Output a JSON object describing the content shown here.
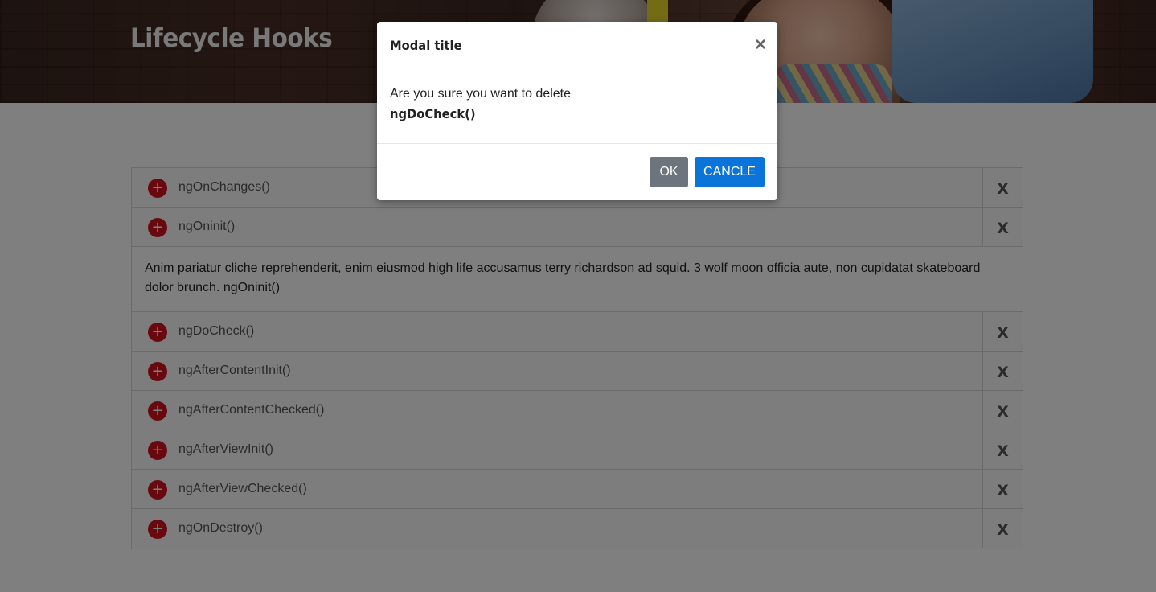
{
  "header": {
    "title": "Lifecycle Hooks"
  },
  "hooks": [
    {
      "label": "ngOnChanges()",
      "close": "X"
    },
    {
      "label": "ngOninit()",
      "close": "X"
    },
    {
      "label": "ngDoCheck()",
      "close": "X"
    },
    {
      "label": "ngAfterContentInit()",
      "close": "X"
    },
    {
      "label": "ngAfterContentChecked()",
      "close": "X"
    },
    {
      "label": "ngAfterViewInit()",
      "close": "X"
    },
    {
      "label": "ngAfterViewChecked()",
      "close": "X"
    },
    {
      "label": "ngOnDestroy()",
      "close": "X"
    }
  ],
  "expanded_panel": {
    "text": "Anim pariatur cliche reprehenderit, enim eiusmod high life accusamus terry richardson ad squid. 3 wolf moon officia aute, non cupidatat skateboard dolor brunch. ngOninit()"
  },
  "expand_icon": "+",
  "modal": {
    "title": "Modal title",
    "close_glyph": "×",
    "message": "Are you sure you want to delete",
    "target": "ngDoCheck()",
    "ok_label": "OK",
    "cancel_label": "CANCLE"
  },
  "colors": {
    "expand_icon": "#d0101f",
    "ok_button": "#6c757d",
    "cancel_button": "#0a74d9"
  }
}
